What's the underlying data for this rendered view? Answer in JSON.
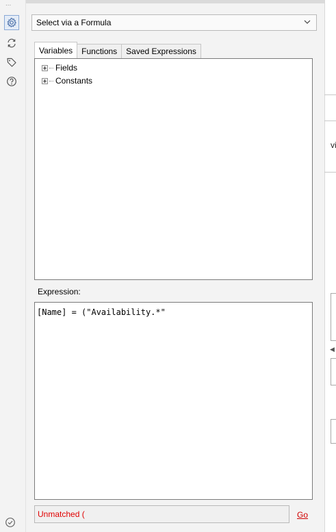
{
  "rail": {
    "overflow_glyph": "...",
    "items": [
      {
        "icon": "gear-icon",
        "active": true
      },
      {
        "icon": "refresh-icon",
        "active": false
      },
      {
        "icon": "tag-icon",
        "active": false
      },
      {
        "icon": "help-icon",
        "active": false
      }
    ],
    "bottom_icon": "checkmark-circle-icon"
  },
  "mode_select": {
    "value": "Select via a Formula"
  },
  "tabs": [
    {
      "label": "Variables",
      "active": true
    },
    {
      "label": "Functions",
      "active": false
    },
    {
      "label": "Saved Expressions",
      "active": false
    }
  ],
  "tree": {
    "items": [
      {
        "label": "Fields",
        "expanded": false
      },
      {
        "label": "Constants",
        "expanded": false
      }
    ]
  },
  "expression": {
    "label": "Expression:",
    "value": "[Name] = (\"Availability.*\""
  },
  "status": {
    "message": "Unmatched (",
    "go_label": "Go"
  },
  "background_canvas": {
    "partial_text": "vi"
  },
  "colors": {
    "error": "#e00000",
    "accent": "#5a7fc0",
    "panel_bg": "#f3f3f3"
  }
}
